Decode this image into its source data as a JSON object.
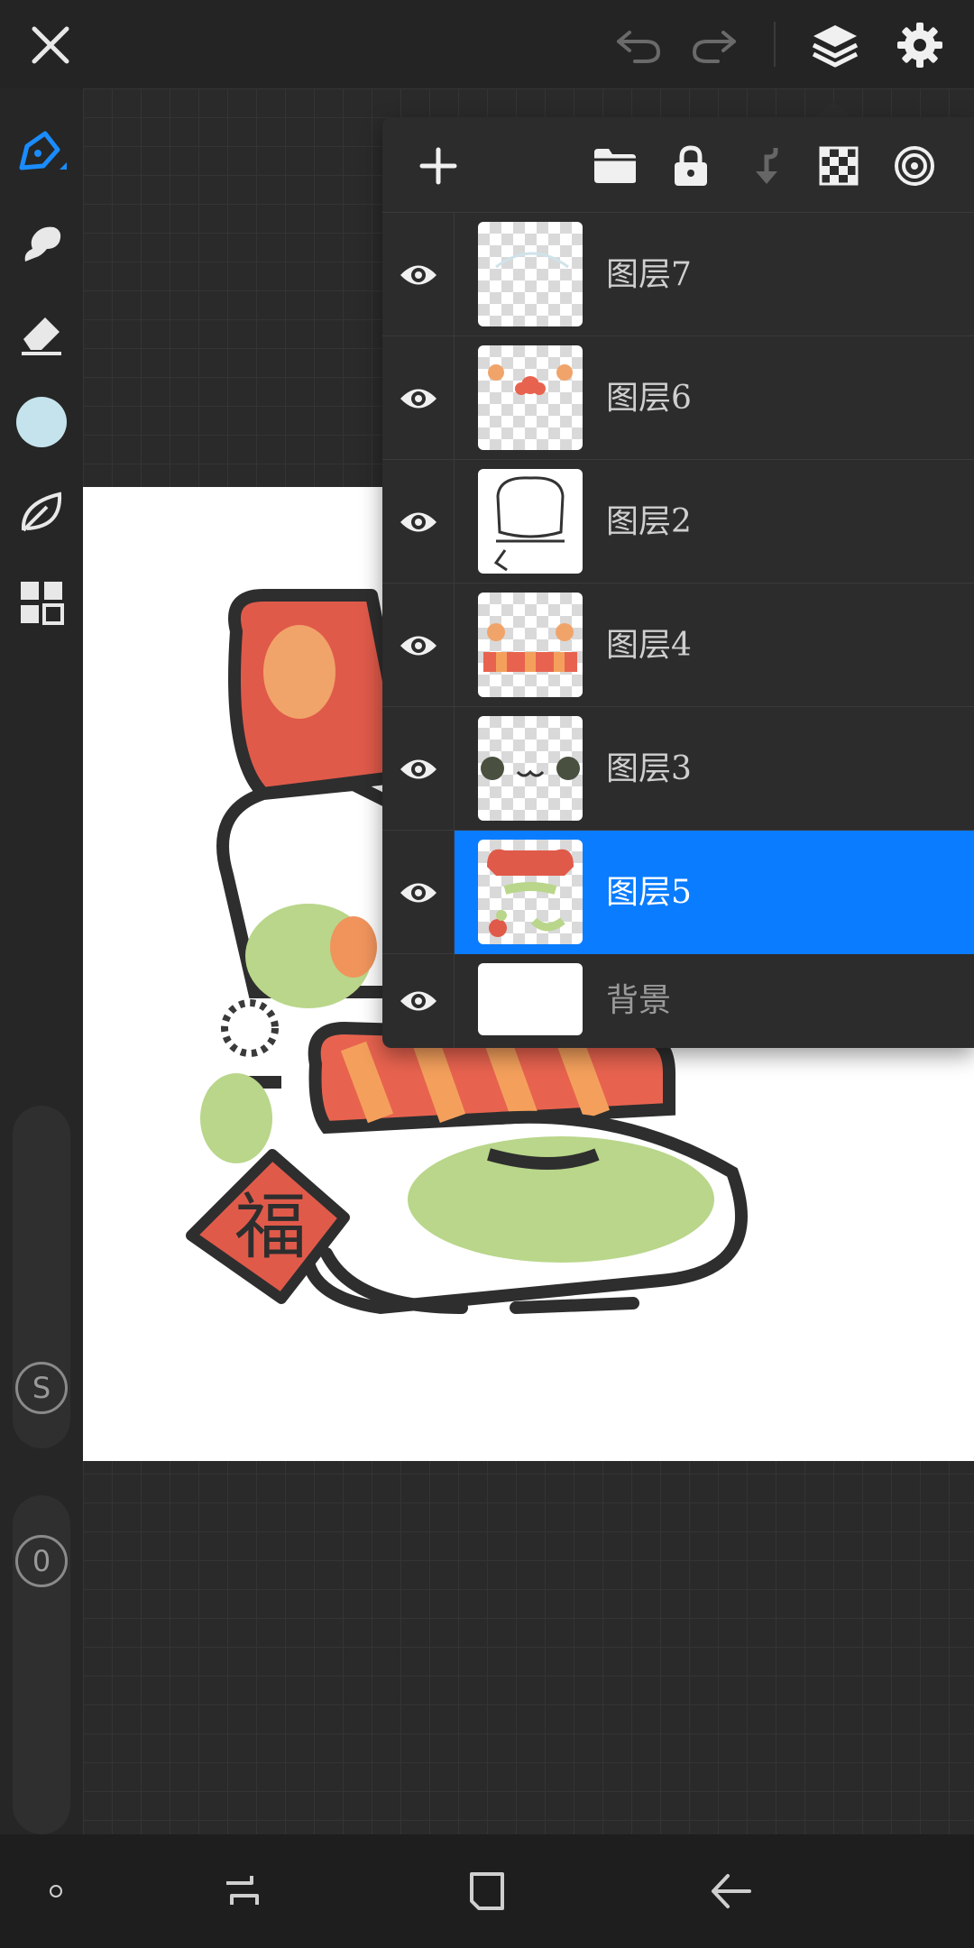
{
  "toolbar": {
    "close": "close",
    "undo": "undo",
    "redo": "redo",
    "layers": "layers",
    "settings": "settings"
  },
  "left_tools": [
    {
      "name": "brush-tool",
      "icon": "pen-icon",
      "active": true
    },
    {
      "name": "smudge-tool",
      "icon": "smudge-icon"
    },
    {
      "name": "eraser-tool",
      "icon": "eraser-icon"
    },
    {
      "name": "color-swatch",
      "icon": "color-circle",
      "color": "#c5e3ec"
    },
    {
      "name": "liquify-tool",
      "icon": "leaf-icon"
    },
    {
      "name": "gallery-tool",
      "icon": "grid-icon"
    }
  ],
  "sliders": {
    "size_label": "S",
    "opacity_label": "0"
  },
  "layers_panel": {
    "layers": [
      {
        "name": "图层7",
        "visible": true,
        "selected": false
      },
      {
        "name": "图层6",
        "visible": true,
        "selected": false
      },
      {
        "name": "图层2",
        "visible": true,
        "selected": false
      },
      {
        "name": "图层4",
        "visible": true,
        "selected": false
      },
      {
        "name": "图层3",
        "visible": true,
        "selected": false
      },
      {
        "name": "图层5",
        "visible": true,
        "selected": true
      },
      {
        "name": "背景",
        "visible": true,
        "selected": false
      }
    ]
  },
  "artwork": {
    "charm_text": "福"
  },
  "colors": {
    "accent": "#0a7cff",
    "panel": "#2c2c2c",
    "background": "#262626"
  }
}
